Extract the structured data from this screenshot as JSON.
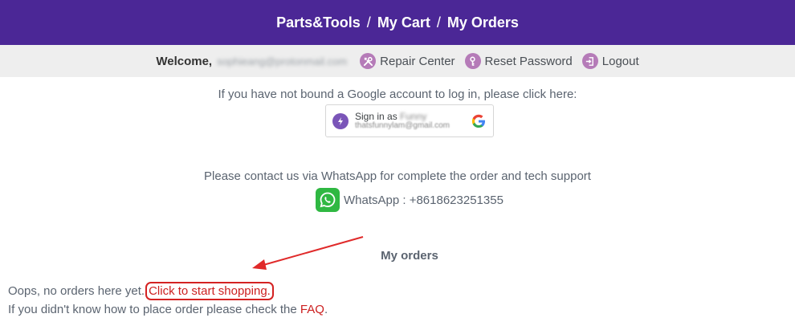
{
  "nav": {
    "crumbs": [
      "Parts&Tools",
      "My Cart",
      "My Orders"
    ],
    "separator": "/"
  },
  "userbar": {
    "welcome": "Welcome,",
    "email": "sophieang@protonmail.com",
    "links": [
      {
        "label": "Repair Center",
        "icon": "tools-icon"
      },
      {
        "label": "Reset Password",
        "icon": "key-icon"
      },
      {
        "label": "Logout",
        "icon": "logout-icon"
      }
    ]
  },
  "google": {
    "note": "If you have not bound a Google account to log in, please click here:",
    "sign_in_prefix": "Sign in as",
    "name": "Funny",
    "email": "thatsfunnylam@gmail.com"
  },
  "contact": {
    "note": "Please contact us via WhatsApp for complete the order and tech support",
    "whatsapp": "WhatsApp : +8618623251355"
  },
  "orders": {
    "title": "My orders",
    "empty_text": "Oops, no orders here yet.",
    "shop_link": "Click to start shopping.",
    "help_text": "If you didn't know how to place order please check the",
    "faq_link": "FAQ",
    "help_end": "."
  },
  "colors": {
    "brand_purple": "#4b2796",
    "icon_pink": "#b57bb8",
    "link_red": "#cc1f1f",
    "whatsapp_green": "#2fb842"
  }
}
